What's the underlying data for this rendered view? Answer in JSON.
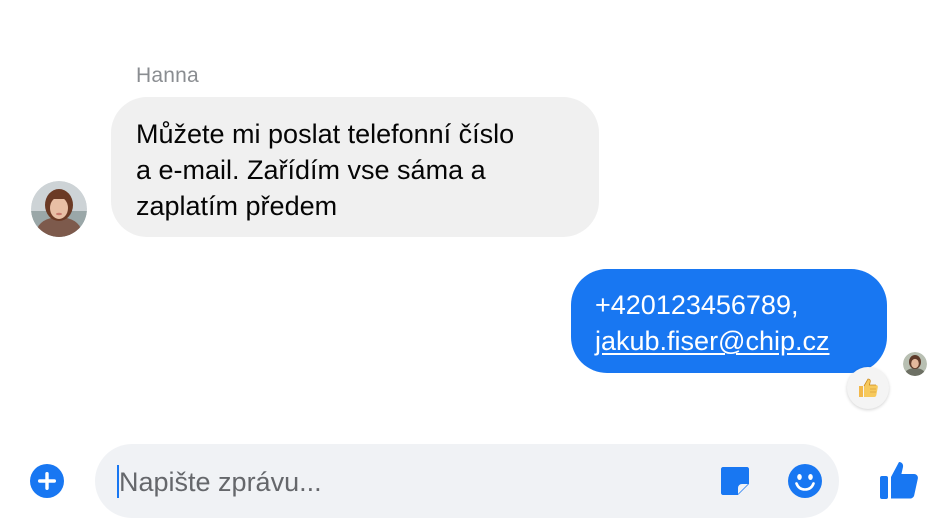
{
  "conversation": {
    "incoming": {
      "sender_name": "Hanna",
      "lines": [
        "Můžete mi poslat telefonní číslo",
        "a e-mail. Zařídím vse sáma a",
        "zaplatím předem"
      ]
    },
    "outgoing": {
      "phone": "+420123456789,",
      "email": "jakub.fiser@chip.cz",
      "reaction_icon": "thumbs-up-emoji"
    }
  },
  "composer": {
    "placeholder": "Napište zprávu...",
    "icons": {
      "add": "plus-circle-icon",
      "sticker": "sticker-icon",
      "emoji": "smiley-icon",
      "like": "thumbs-up-icon"
    }
  },
  "colors": {
    "accent": "#1877f2",
    "incoming_bubble": "#f0f0f0",
    "composer_bg": "#f0f2f5",
    "secondary_text": "#65676b"
  }
}
